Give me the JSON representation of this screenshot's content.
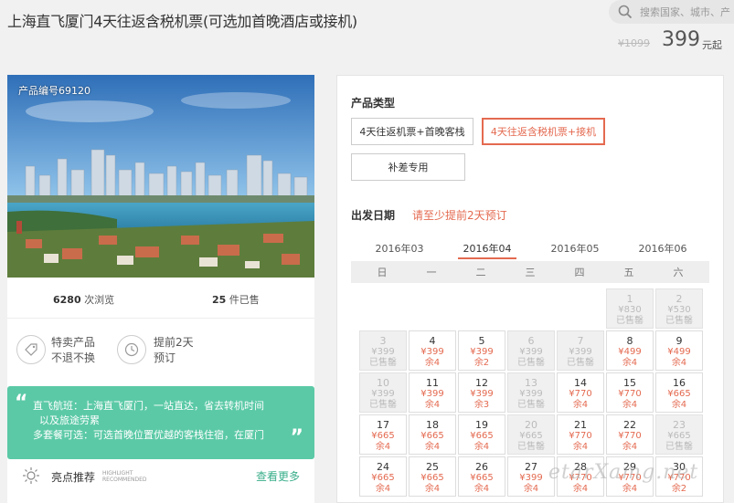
{
  "header": {
    "title": "上海直飞厦门4天往返含税机票(可选加首晚酒店或接机)",
    "search_placeholder": "搜索国家、城市、产",
    "old_price": "¥1099",
    "price": "399",
    "price_unit": "元起"
  },
  "product": {
    "code_label": "产品编号69120",
    "views_num": "6280",
    "views_label": "次浏览",
    "sold_num": "25",
    "sold_label": "件已售",
    "features": [
      {
        "icon": "tag-icon",
        "line1": "特卖产品",
        "line2": "不退不换"
      },
      {
        "icon": "clock-icon",
        "line1": "提前2天",
        "line2": "预订"
      }
    ],
    "highlight_lines": [
      "直飞航班：上海直飞厦门，一站直达，省去转机时间",
      "以及旅途劳累",
      "多套餐可选：可选首晚位置优越的客栈住宿，在厦门"
    ],
    "highlight_title": "亮点推荐",
    "highlight_en1": "HIGHLIGHT",
    "highlight_en2": "RECOMMENDED",
    "view_more": "查看更多"
  },
  "booking": {
    "type_label": "产品类型",
    "options": [
      "4天往返机票+首晚客栈",
      "4天往返含税机票+接机",
      "补差专用"
    ],
    "selected_option": 1,
    "date_label": "出发日期",
    "date_hint": "请至少提前2天预订",
    "months": [
      "2016年03",
      "2016年04",
      "2016年05",
      "2016年06"
    ],
    "active_month": 1,
    "weekdays": [
      "日",
      "一",
      "二",
      "三",
      "四",
      "五",
      "六"
    ],
    "days": [
      {
        "day": "1",
        "price": "¥830",
        "status": "已售罄",
        "off": true,
        "col": 5,
        "row": 0
      },
      {
        "day": "2",
        "price": "¥530",
        "status": "已售罄",
        "off": true,
        "col": 6,
        "row": 0
      },
      {
        "day": "3",
        "price": "¥399",
        "status": "已售罄",
        "off": true,
        "col": 0,
        "row": 1
      },
      {
        "day": "4",
        "price": "¥399",
        "status": "余4",
        "off": false,
        "col": 1,
        "row": 1
      },
      {
        "day": "5",
        "price": "¥399",
        "status": "余2",
        "off": false,
        "col": 2,
        "row": 1
      },
      {
        "day": "6",
        "price": "¥399",
        "status": "已售罄",
        "off": true,
        "col": 3,
        "row": 1
      },
      {
        "day": "7",
        "price": "¥399",
        "status": "已售罄",
        "off": true,
        "col": 4,
        "row": 1
      },
      {
        "day": "8",
        "price": "¥499",
        "status": "余4",
        "off": false,
        "col": 5,
        "row": 1
      },
      {
        "day": "9",
        "price": "¥499",
        "status": "余4",
        "off": false,
        "col": 6,
        "row": 1
      },
      {
        "day": "10",
        "price": "¥399",
        "status": "已售罄",
        "off": true,
        "col": 0,
        "row": 2
      },
      {
        "day": "11",
        "price": "¥399",
        "status": "余4",
        "off": false,
        "col": 1,
        "row": 2
      },
      {
        "day": "12",
        "price": "¥399",
        "status": "余3",
        "off": false,
        "col": 2,
        "row": 2
      },
      {
        "day": "13",
        "price": "¥399",
        "status": "已售罄",
        "off": true,
        "col": 3,
        "row": 2
      },
      {
        "day": "14",
        "price": "¥770",
        "status": "余4",
        "off": false,
        "col": 4,
        "row": 2
      },
      {
        "day": "15",
        "price": "¥770",
        "status": "余4",
        "off": false,
        "col": 5,
        "row": 2
      },
      {
        "day": "16",
        "price": "¥665",
        "status": "余4",
        "off": false,
        "col": 6,
        "row": 2
      },
      {
        "day": "17",
        "price": "¥665",
        "status": "余4",
        "off": false,
        "col": 0,
        "row": 3
      },
      {
        "day": "18",
        "price": "¥665",
        "status": "余4",
        "off": false,
        "col": 1,
        "row": 3
      },
      {
        "day": "19",
        "price": "¥665",
        "status": "余4",
        "off": false,
        "col": 2,
        "row": 3
      },
      {
        "day": "20",
        "price": "¥665",
        "status": "已售罄",
        "off": true,
        "col": 3,
        "row": 3
      },
      {
        "day": "21",
        "price": "¥770",
        "status": "余4",
        "off": false,
        "col": 4,
        "row": 3
      },
      {
        "day": "22",
        "price": "¥770",
        "status": "余4",
        "off": false,
        "col": 5,
        "row": 3
      },
      {
        "day": "23",
        "price": "¥665",
        "status": "已售罄",
        "off": true,
        "col": 6,
        "row": 3
      },
      {
        "day": "24",
        "price": "¥665",
        "status": "余4",
        "off": false,
        "col": 0,
        "row": 4
      },
      {
        "day": "25",
        "price": "¥665",
        "status": "余4",
        "off": false,
        "col": 1,
        "row": 4
      },
      {
        "day": "26",
        "price": "¥665",
        "status": "余4",
        "off": false,
        "col": 2,
        "row": 4
      },
      {
        "day": "27",
        "price": "¥399",
        "status": "余4",
        "off": false,
        "col": 3,
        "row": 4
      },
      {
        "day": "28",
        "price": "¥770",
        "status": "余4",
        "off": false,
        "col": 4,
        "row": 4
      },
      {
        "day": "29",
        "price": "¥770",
        "status": "余4",
        "off": false,
        "col": 5,
        "row": 4
      },
      {
        "day": "30",
        "price": "¥770",
        "status": "余2",
        "off": false,
        "col": 6,
        "row": 4
      }
    ]
  },
  "watermark": "etarXamg.net",
  "colors": {
    "accent": "#e46a50",
    "green": "#5bc9a6"
  }
}
